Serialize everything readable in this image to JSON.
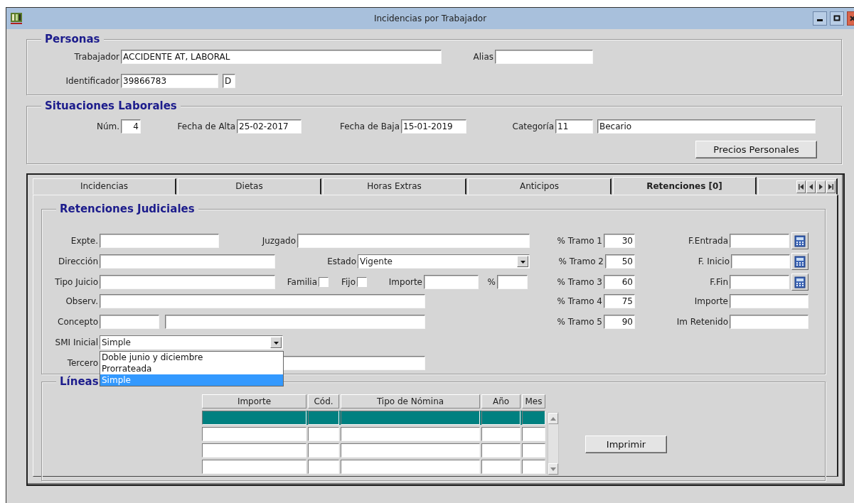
{
  "window": {
    "title": "Incidencias por Trabajador"
  },
  "personas": {
    "legend": "Personas",
    "trabajador": {
      "label": "Trabajador",
      "value": "ACCIDENTE AT, LABORAL"
    },
    "alias": {
      "label": "Alias"
    },
    "identificador": {
      "label": "Identificador",
      "value": "39866783"
    },
    "identificador_letra": {
      "value": "D"
    }
  },
  "situaciones": {
    "legend": "Situaciones Laborales",
    "num": {
      "label": "Núm.",
      "value": "4"
    },
    "fecha_alta": {
      "label": "Fecha de Alta",
      "value": "25-02-2017"
    },
    "fecha_baja": {
      "label": "Fecha de Baja",
      "value": "15-01-2019"
    },
    "categoria": {
      "label": "Categoría",
      "code": "11",
      "value": "Becario"
    },
    "precios_button": "Precios Personales"
  },
  "tabs": [
    {
      "label": "Incidencias",
      "selected": false
    },
    {
      "label": "Dietas",
      "selected": false
    },
    {
      "label": "Horas Extras",
      "selected": false
    },
    {
      "label": "Anticipos",
      "selected": false
    },
    {
      "label": "Retenciones [0]",
      "selected": true
    }
  ],
  "retenciones": {
    "legend": "Retenciones Judiciales",
    "expte": {
      "label": "Expte."
    },
    "juzgado": {
      "label": "Juzgado"
    },
    "direccion": {
      "label": "Dirección"
    },
    "estado": {
      "label": "Estado",
      "value": "Vigente"
    },
    "tipo_juicio": {
      "label": "Tipo Juicio"
    },
    "familia": {
      "label": "Familia",
      "checked": false
    },
    "fijo": {
      "label": "Fijo",
      "checked": false
    },
    "importe": {
      "label": "Importe"
    },
    "porcentaje": {
      "label": "%"
    },
    "observ": {
      "label": "Observ."
    },
    "concepto": {
      "label": "Concepto"
    },
    "smi_inicial": {
      "label": "SMI Inicial",
      "value": "Simple",
      "expanded": true,
      "options": [
        {
          "label": "Doble junio y diciembre",
          "selected": false
        },
        {
          "label": "Prorrateada",
          "selected": false
        },
        {
          "label": "Simple",
          "selected": true
        }
      ]
    },
    "tercero": {
      "label": "Tercero"
    },
    "tramos": [
      {
        "label": "% Tramo 1",
        "value": "30"
      },
      {
        "label": "% Tramo 2",
        "value": "50"
      },
      {
        "label": "% Tramo 3",
        "value": "60"
      },
      {
        "label": "% Tramo 4",
        "value": "75"
      },
      {
        "label": "% Tramo 5",
        "value": "90"
      }
    ],
    "f_entrada": {
      "label": "F.Entrada"
    },
    "f_inicio": {
      "label": "F. Inicio"
    },
    "f_fin": {
      "label": "F.Fin"
    },
    "importe_total": {
      "label": "Importe"
    },
    "im_retenido": {
      "label": "Im Retenido"
    }
  },
  "lineas": {
    "legend": "Líneas",
    "table": {
      "columns": [
        "Importe",
        "Cód.",
        "Tipo de Nómina",
        "Año",
        "Mes"
      ],
      "rows": [
        {
          "selected": true
        },
        {
          "selected": false
        },
        {
          "selected": false
        },
        {
          "selected": false
        }
      ]
    },
    "imprimir_button": "Imprimir"
  }
}
